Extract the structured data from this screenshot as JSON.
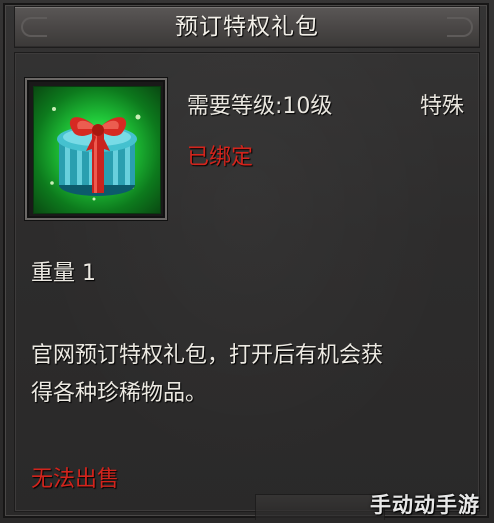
{
  "tooltip": {
    "title": "预订特权礼包",
    "item": {
      "icon": "gift-box-icon",
      "required_level": "需要等级:10级",
      "category": "特殊",
      "bind_status": "已绑定",
      "weight": "重量 1",
      "description_line1": "官网预订特权礼包，打开后有机会获",
      "description_line2": "得各种珍稀物品。",
      "sell_status": "无法出售"
    },
    "colors": {
      "title_text": "#f2efe8",
      "body_text": "#e9e6df",
      "warning_red": "#d3241c",
      "icon_glow": "#21c93a"
    }
  },
  "watermark": "手动动手游"
}
